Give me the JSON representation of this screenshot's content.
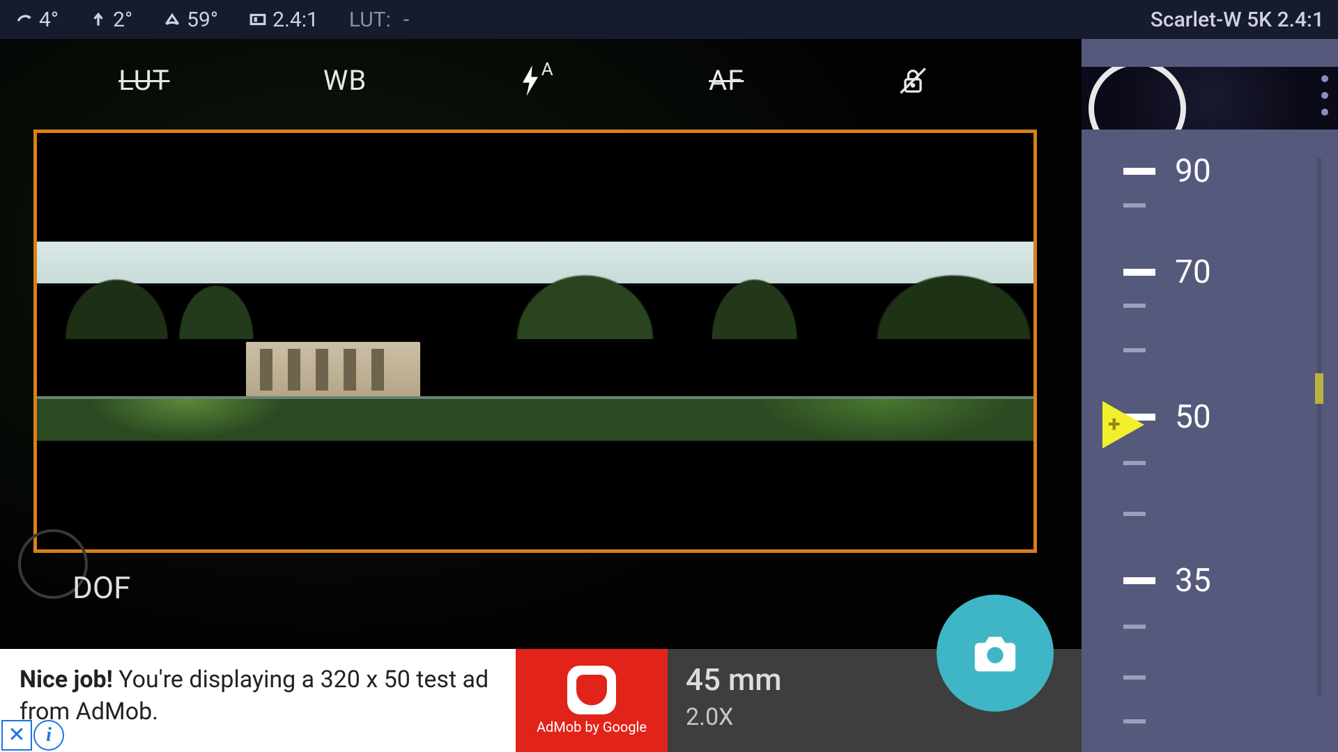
{
  "statusbar": {
    "roll": "4°",
    "tilt": "2°",
    "fov": "59°",
    "aspect": "2.4:1",
    "lut_label": "LUT:",
    "lut_value": "-",
    "camera_profile": "Scarlet-W 5K 2.4:1"
  },
  "toolbar": {
    "lut": "LUT",
    "wb": "WB",
    "flash_mode": "A",
    "af": "AF"
  },
  "dof_label": "DOF",
  "bottom": {
    "ad_bold": "Nice job!",
    "ad_rest": " You're displaying a 320 x 50 test ad from AdMob.",
    "admob_text": "AdMob by Google",
    "focal_mm": "45 mm",
    "focal_zoom": "2.0X"
  },
  "ruler": {
    "marks": [
      {
        "value": "90",
        "pos": 7,
        "major": true
      },
      {
        "value": "",
        "pos": 15,
        "major": false
      },
      {
        "value": "70",
        "pos": 23,
        "major": true
      },
      {
        "value": "",
        "pos": 31,
        "major": false
      },
      {
        "value": "",
        "pos": 38,
        "major": false
      },
      {
        "value": "50",
        "pos": 46,
        "major": true
      },
      {
        "value": "",
        "pos": 56,
        "major": false
      },
      {
        "value": "",
        "pos": 64,
        "major": false
      },
      {
        "value": "35",
        "pos": 72,
        "major": true
      },
      {
        "value": "",
        "pos": 82,
        "major": false
      },
      {
        "value": "",
        "pos": 90,
        "major": false
      },
      {
        "value": "",
        "pos": 97,
        "major": false
      }
    ]
  }
}
